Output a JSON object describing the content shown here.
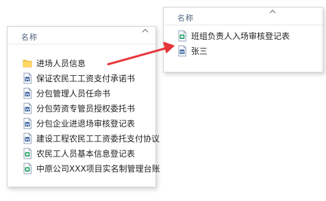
{
  "left_pane": {
    "column_header": "名称",
    "items": [
      {
        "label": "进场人员信息",
        "icon": "folder-icon"
      },
      {
        "label": "保证农民工工资支付承诺书",
        "icon": "word-doc-icon"
      },
      {
        "label": "分包管理人员任命书",
        "icon": "word-doc-icon"
      },
      {
        "label": "分包劳资专管员授权委托书",
        "icon": "word-doc-icon"
      },
      {
        "label": "分包企业进退场审核登记表",
        "icon": "word-doc-icon"
      },
      {
        "label": "建设工程农民工工资委托支付协议",
        "icon": "word-doc-icon"
      },
      {
        "label": "农民工人员基本信息登记表",
        "icon": "excel-doc-icon"
      },
      {
        "label": "中原公司XXX项目实名制管理台账",
        "icon": "excel-doc-icon"
      }
    ]
  },
  "right_pane": {
    "column_header": "名称",
    "items": [
      {
        "label": "班组负责人入场审核登记表",
        "icon": "excel-doc-icon"
      },
      {
        "label": "张三",
        "icon": "word-doc-icon"
      }
    ]
  },
  "colors": {
    "arrow": "#e8363b",
    "folder": "#f5c443",
    "word_accent": "#2b5797",
    "excel_accent": "#21a366"
  }
}
